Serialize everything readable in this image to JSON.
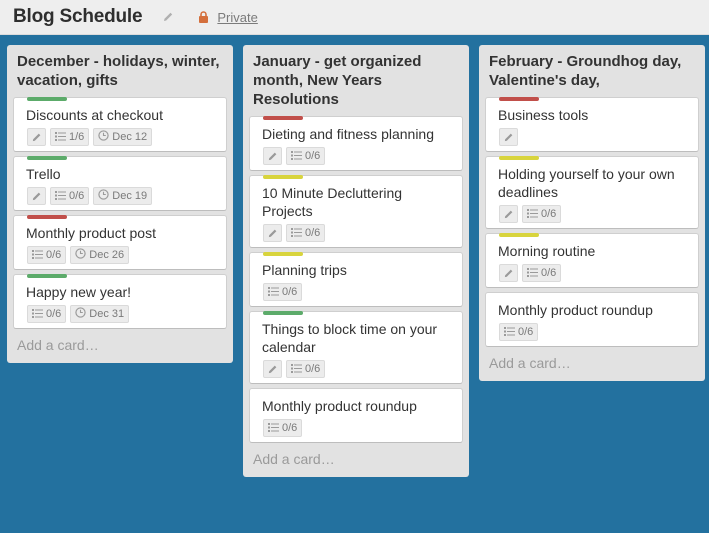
{
  "header": {
    "title": "Blog Schedule",
    "privacy_label": "Private"
  },
  "colors": {
    "green": "#5cab6a",
    "red": "#c14f4a",
    "yellow": "#d8d43d"
  },
  "lists": [
    {
      "title": "December - holidays, winter, vacation, gifts",
      "add_card": "Add a card…",
      "cards": [
        {
          "title": "Discounts at checkout",
          "label": "green",
          "edit": true,
          "checklist": "1/6",
          "due": "Dec 12"
        },
        {
          "title": "Trello",
          "label": "green",
          "edit": true,
          "checklist": "0/6",
          "due": "Dec 19"
        },
        {
          "title": "Monthly product post",
          "label": "red",
          "edit": false,
          "checklist": "0/6",
          "due": "Dec 26"
        },
        {
          "title": "Happy new year!",
          "label": "green",
          "edit": false,
          "checklist": "0/6",
          "due": "Dec 31"
        }
      ]
    },
    {
      "title": "January - get organized month, New Years Resolutions",
      "add_card": "Add a card…",
      "cards": [
        {
          "title": "Dieting and fitness planning",
          "label": "red",
          "edit": true,
          "checklist": "0/6",
          "due": null
        },
        {
          "title": "10 Minute Decluttering Projects",
          "label": "yellow",
          "edit": true,
          "checklist": "0/6",
          "due": null
        },
        {
          "title": "Planning trips",
          "label": "yellow",
          "edit": false,
          "checklist": "0/6",
          "due": null
        },
        {
          "title": "Things to block time on your calendar",
          "label": "green",
          "edit": true,
          "checklist": "0/6",
          "due": null
        },
        {
          "title": "Monthly product roundup",
          "label": null,
          "edit": false,
          "checklist": "0/6",
          "due": null
        }
      ]
    },
    {
      "title": "February - Groundhog day, Valentine's day,",
      "add_card": "Add a card…",
      "cards": [
        {
          "title": "Business tools",
          "label": "red",
          "edit": true,
          "checklist": null,
          "due": null
        },
        {
          "title": "Holding yourself to your own deadlines",
          "label": "yellow",
          "edit": true,
          "checklist": "0/6",
          "due": null
        },
        {
          "title": "Morning routine",
          "label": "yellow",
          "edit": true,
          "checklist": "0/6",
          "due": null
        },
        {
          "title": "Monthly product roundup",
          "label": null,
          "edit": false,
          "checklist": "0/6",
          "due": null
        }
      ]
    }
  ]
}
